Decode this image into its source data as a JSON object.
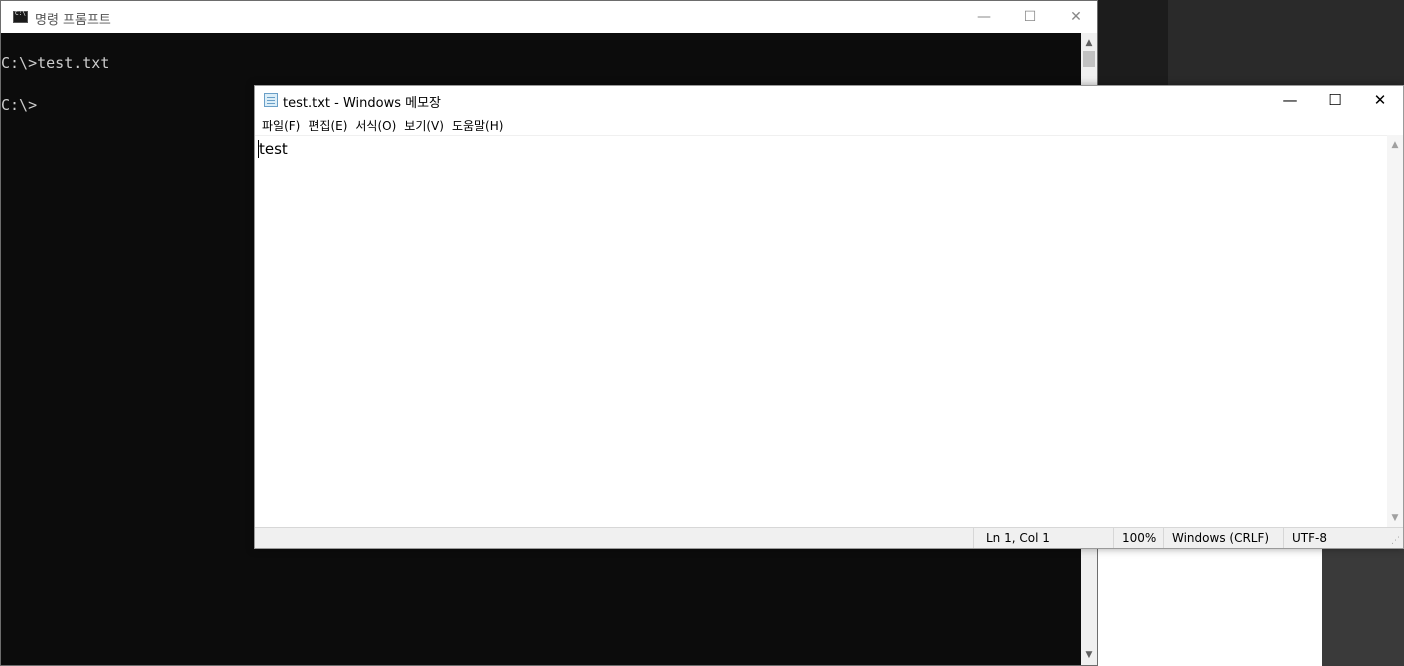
{
  "cmd": {
    "title": "명령 프롬프트",
    "lines": [
      "C:\\>test.txt",
      "C:\\>"
    ],
    "buttons": {
      "minimize": "—",
      "maximize": "☐",
      "close": "✕"
    }
  },
  "notepad": {
    "title": "test.txt - Windows 메모장",
    "menu": [
      "파일(F)",
      "편집(E)",
      "서식(O)",
      "보기(V)",
      "도움말(H)"
    ],
    "content": "test",
    "buttons": {
      "minimize": "—",
      "maximize": "☐",
      "close": "✕"
    },
    "status": {
      "position": "Ln 1, Col 1",
      "zoom": "100%",
      "line_ending": "Windows (CRLF)",
      "encoding": "UTF-8"
    }
  }
}
